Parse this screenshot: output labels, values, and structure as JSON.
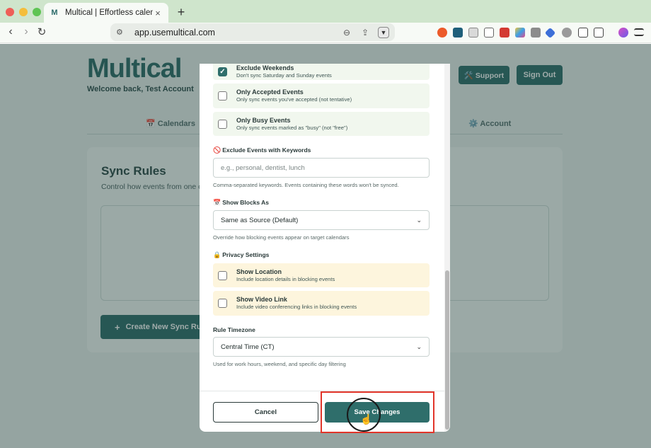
{
  "browser": {
    "tab_title": "Multical | Effortless calendar s",
    "tab_favicon": "M",
    "tab_close": "×",
    "new_tab": "+",
    "url": "app.usemultical.com",
    "nav": {
      "back": "‹",
      "forward": "›",
      "reload": "↻"
    },
    "extensions": [
      "red-plus",
      "letter-block",
      "page",
      "code",
      "pdf",
      "color-grid",
      "camera",
      "blue-diamond",
      "im-circle",
      "puzzle",
      "reader",
      "profile",
      "menu"
    ]
  },
  "page": {
    "logo": "Multical",
    "welcome": "Welcome back, Test Account",
    "support_label": "🛠️ Support",
    "signout_label": "Sign Out",
    "nav_tabs": [
      "📅 Calendars",
      "⚙️ Account"
    ],
    "sync_title": "Sync Rules",
    "sync_desc": "Control how events from one cale",
    "create_label": "Create New Sync Rule",
    "create_plus": "+"
  },
  "modal": {
    "options_top": [
      {
        "label": "Exclude Weekends",
        "desc": "Don't sync Saturday and Sunday events",
        "checked": true
      },
      {
        "label": "Only Accepted Events",
        "desc": "Only sync events you've accepted (not tentative)",
        "checked": false
      },
      {
        "label": "Only Busy Events",
        "desc": "Only sync events marked as \"busy\" (not \"free\")",
        "checked": false
      }
    ],
    "keywords": {
      "emoji": "🚫",
      "title": "Exclude Events with Keywords",
      "placeholder": "e.g., personal, dentist, lunch",
      "hint": "Comma-separated keywords. Events containing these words won't be synced."
    },
    "show_blocks": {
      "emoji": "📅",
      "title": "Show Blocks As",
      "value": "Same as Source (Default)",
      "hint": "Override how blocking events appear on target calendars"
    },
    "privacy": {
      "emoji": "🔒",
      "title": "Privacy Settings",
      "options": [
        {
          "label": "Show Location",
          "desc": "Include location details in blocking events",
          "checked": false
        },
        {
          "label": "Show Video Link",
          "desc": "Include video conferencing links in blocking events",
          "checked": false
        }
      ]
    },
    "timezone": {
      "title": "Rule Timezone",
      "value": "Central Time (CT)",
      "hint": "Used for work hours, weekend, and specific day filtering"
    },
    "cancel_label": "Cancel",
    "save_label": "Save Changes",
    "chevron": "⌄",
    "check_mark": "✓"
  },
  "colors": {
    "accent": "#2f6e6b",
    "highlight": "#e2352a",
    "yellow_option": "#fdf5dd",
    "green_option": "#f1f7ee"
  }
}
